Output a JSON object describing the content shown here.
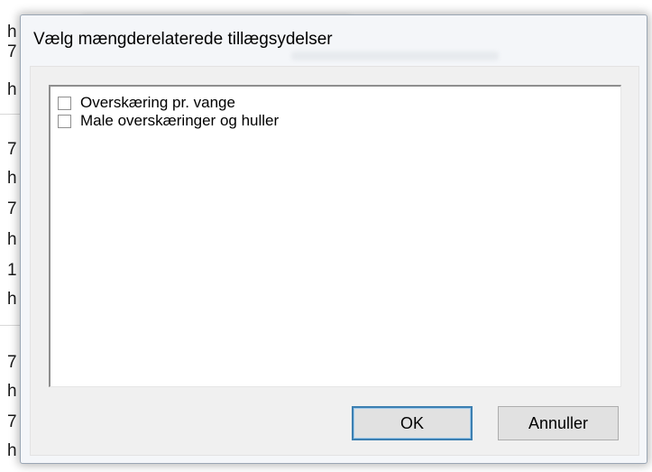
{
  "background_fragments": [
    "h",
    "7",
    "h",
    "7",
    "h",
    "7",
    "h",
    "1",
    "h",
    "7",
    "h",
    "7",
    "h"
  ],
  "dialog": {
    "title": "Vælg mængderelaterede tillægsydelser",
    "items": [
      {
        "label": "Overskæring pr. vange",
        "checked": false
      },
      {
        "label": "Male overskæringer og huller",
        "checked": false
      }
    ],
    "ok_label": "OK",
    "cancel_label": "Annuller"
  },
  "colors": {
    "dialog_background": "#f4f6f9",
    "button_face": "#e1e1e1",
    "default_button_border": "#3c7fb1"
  }
}
